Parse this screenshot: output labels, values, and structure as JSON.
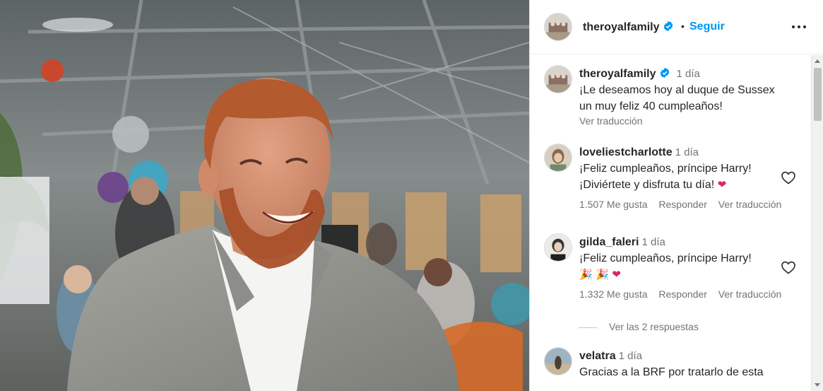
{
  "post": {
    "image_alt": "Foto del duque de Sussex sonriendo"
  },
  "header": {
    "username": "theroyalfamily",
    "separator": "•",
    "follow_label": "Seguir"
  },
  "caption": {
    "username": "theroyalfamily",
    "time": "1 día",
    "text_line1": "¡Le deseamos hoy al duque de Sussex",
    "text_line2": "un muy feliz 40 cumpleaños!",
    "see_translation": "Ver traducción"
  },
  "comments": [
    {
      "username": "loveliestcharlotte",
      "time": "1 día",
      "text_line1": "¡Feliz cumpleaños, príncipe Harry!",
      "text_line2": "¡Diviértete y disfruta tu día!",
      "emoji": "❤",
      "likes": "1.507 Me gusta",
      "reply": "Responder",
      "translate": "Ver traducción"
    },
    {
      "username": "gilda_faleri",
      "time": "1 día",
      "text_line1": "¡Feliz cumpleaños, príncipe Harry!",
      "text_line2": "",
      "emoji1": "🎉",
      "emoji2": "🎉",
      "emoji3": "❤",
      "likes": "1.332 Me gusta",
      "reply": "Responder",
      "translate": "Ver traducción"
    },
    {
      "username": "velatra",
      "time": "1 día",
      "text_line1": "Gracias a la BRF por tratarlo de esta"
    }
  ],
  "view_replies": "Ver las 2 respuestas",
  "icons": {
    "verified": "verified-badge-icon",
    "more": "more-options-icon",
    "like": "heart-outline-icon"
  },
  "colors": {
    "accent": "#0095f6",
    "verified": "#0095f6",
    "muted": "#737373",
    "text": "#262626"
  }
}
